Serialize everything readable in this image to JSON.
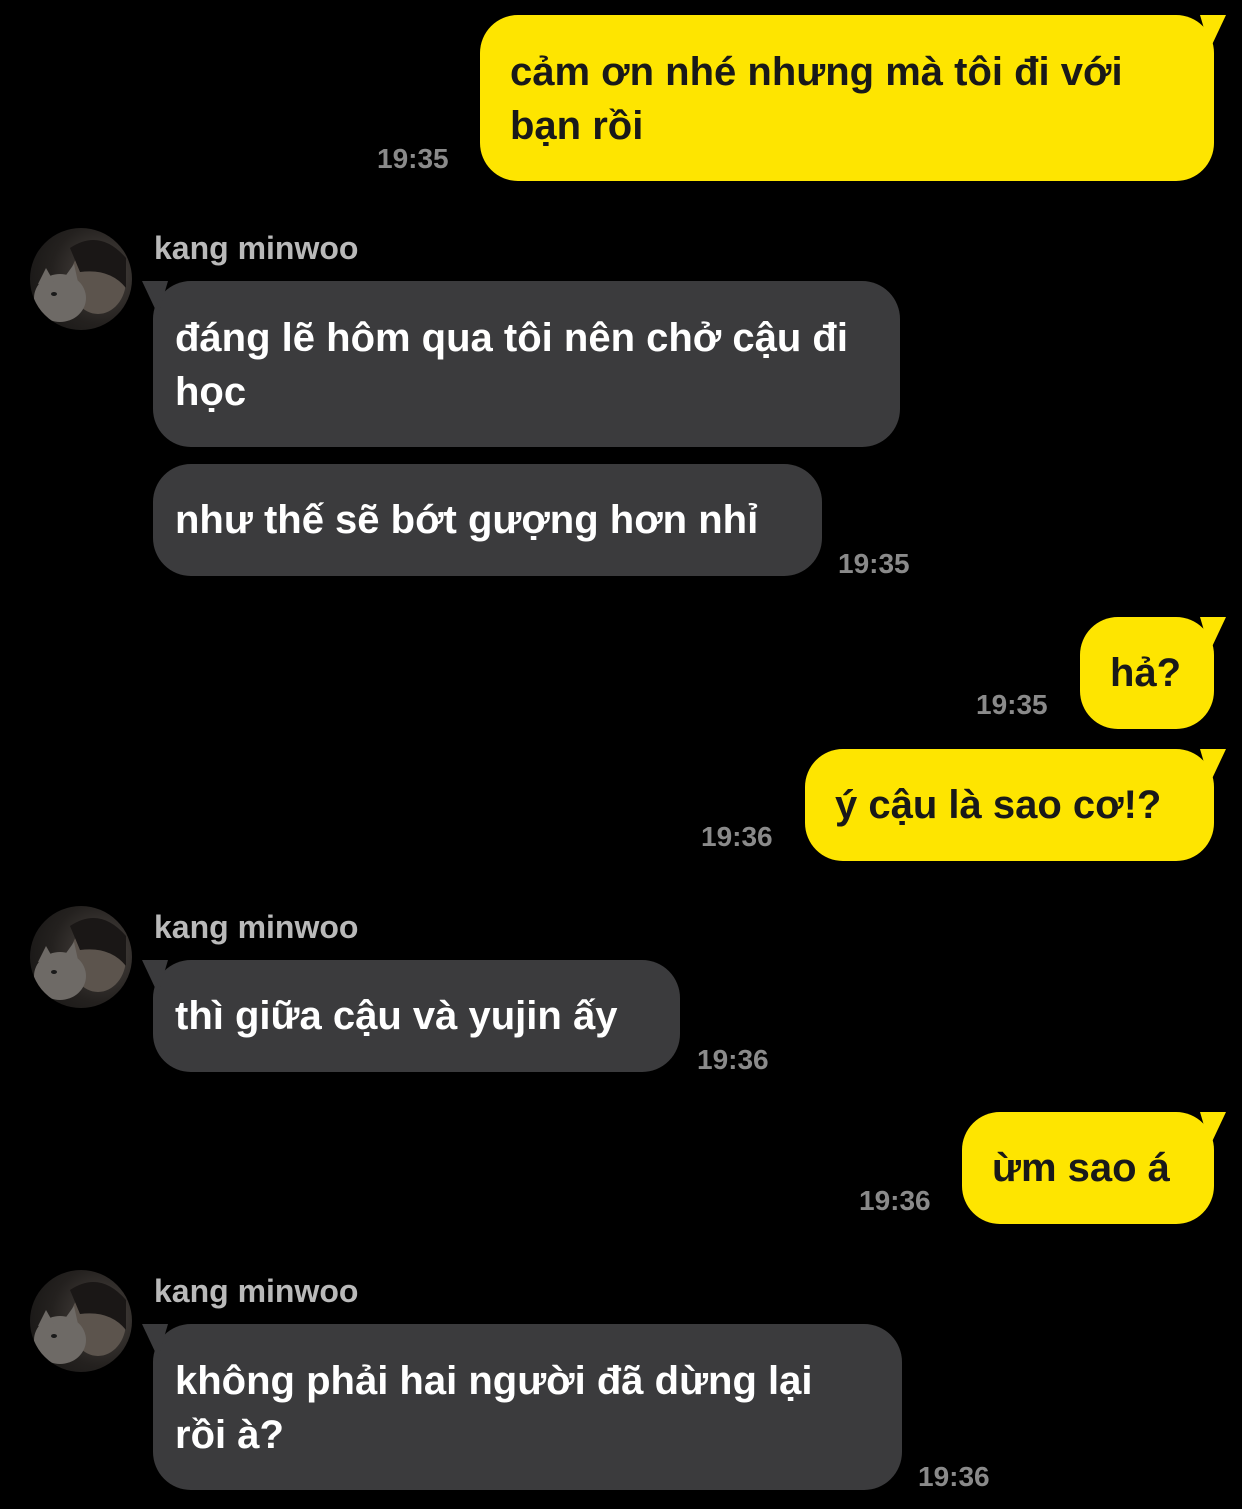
{
  "chat": {
    "messages": [
      {
        "side": "out",
        "text": "cảm ơn nhé nhưng mà tôi đi với bạn rồi",
        "time": "19:35"
      },
      {
        "side": "in",
        "sender": "kang minwoo",
        "text": "đáng lẽ hôm qua tôi nên chở cậu đi học"
      },
      {
        "side": "in",
        "text": "như thế sẽ bớt gượng hơn nhỉ",
        "time": "19:35"
      },
      {
        "side": "out",
        "text": "hả?",
        "time": "19:35"
      },
      {
        "side": "out",
        "text": "ý cậu là sao cơ!?",
        "time": "19:36"
      },
      {
        "side": "in",
        "sender": "kang minwoo",
        "text": "thì giữa cậu và yujin ấy",
        "time": "19:36"
      },
      {
        "side": "out",
        "text": "ừm sao á",
        "time": "19:36"
      },
      {
        "side": "in",
        "sender": "kang minwoo",
        "text": "không phải hai người đã dừng lại rồi à?",
        "time": "19:36"
      }
    ]
  },
  "colors": {
    "background": "#000000",
    "outgoing_bubble": "#FEE500",
    "incoming_bubble": "#3b3b3d",
    "timestamp": "#8a8a8a",
    "sender_name": "#b9b9b9"
  },
  "icons": {
    "avatar": "profile-photo-cat-icon"
  }
}
